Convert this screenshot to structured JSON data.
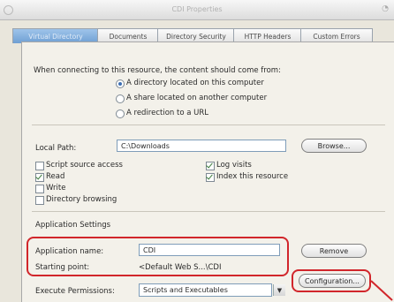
{
  "window": {
    "title": "CDI Properties"
  },
  "tabs": [
    {
      "label": "Virtual Directory",
      "active": true
    },
    {
      "label": "Documents"
    },
    {
      "label": "Directory Security"
    },
    {
      "label": "HTTP Headers"
    },
    {
      "label": "Custom Errors"
    }
  ],
  "content_source": {
    "prompt": "When connecting to this resource, the content should come from:",
    "options": [
      {
        "label": "A directory located on this computer",
        "selected": true
      },
      {
        "label": "A share located on another computer",
        "selected": false
      },
      {
        "label": "A redirection to a URL",
        "selected": false
      }
    ]
  },
  "local_path": {
    "label": "Local Path:",
    "value": "C:\\Downloads",
    "browse_label": "Browse..."
  },
  "permissions_left": [
    {
      "label": "Script source access",
      "checked": false
    },
    {
      "label": "Read",
      "checked": true
    },
    {
      "label": "Write",
      "checked": false
    },
    {
      "label": "Directory browsing",
      "checked": false
    }
  ],
  "permissions_right": [
    {
      "label": "Log visits",
      "checked": true
    },
    {
      "label": "Index this resource",
      "checked": true
    }
  ],
  "app_settings": {
    "section_label": "Application Settings",
    "name_label": "Application name:",
    "name_value": "CDI",
    "remove_label": "Remove",
    "starting_point_label": "Starting point:",
    "starting_point_value": "<Default Web S...\\CDI",
    "configuration_label": "Configuration...",
    "execute_label": "Execute Permissions:",
    "execute_value": "Scripts and Executables"
  },
  "colors": {
    "highlight": "#d1262b",
    "active_tab": "#7aa7d9"
  }
}
